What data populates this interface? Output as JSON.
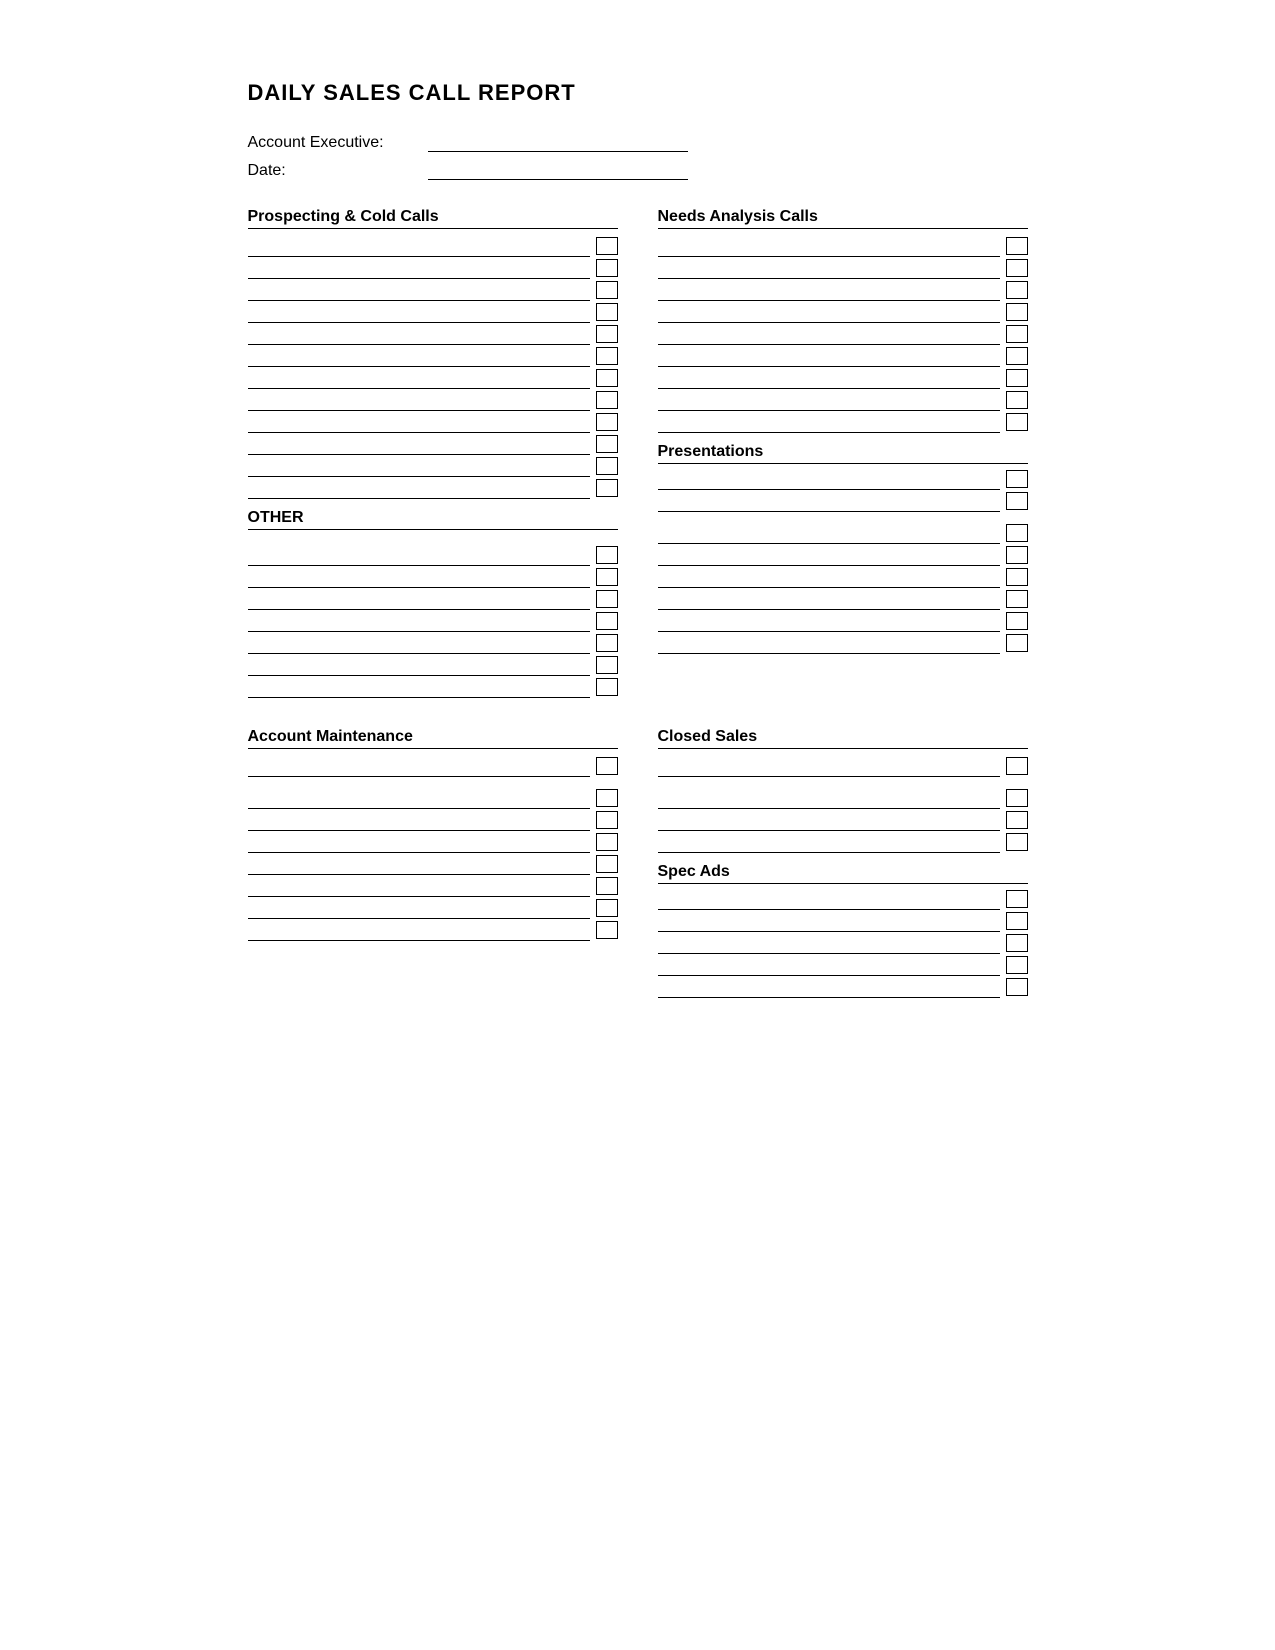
{
  "title": "DAILY SALES CALL REPORT",
  "header": {
    "account_executive_label": "Account Executive:",
    "date_label": "Date:"
  },
  "sections": {
    "prospecting": {
      "title": "Prospecting & Cold Calls",
      "rows": 12
    },
    "other": {
      "title": "OTHER",
      "rows": 7
    },
    "needs_analysis": {
      "title": "Needs Analysis Calls",
      "rows": 9
    },
    "presentations": {
      "title": "Presentations",
      "rows": 8
    },
    "account_maintenance": {
      "title": "Account Maintenance",
      "rows": 8
    },
    "closed_sales": {
      "title": "Closed Sales",
      "rows": 4
    },
    "spec_ads": {
      "title": "Spec Ads",
      "rows": 5
    }
  }
}
